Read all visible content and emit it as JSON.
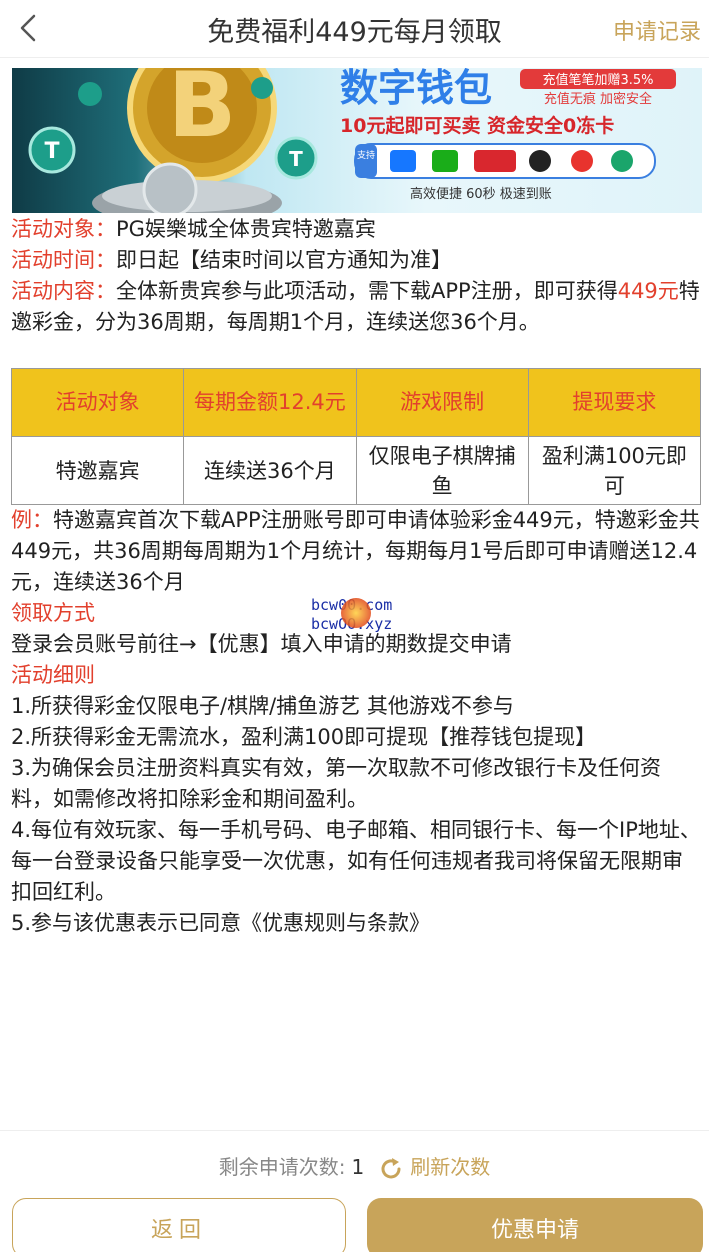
{
  "header": {
    "title": "免费福利449元每月领取",
    "records": "申请记录"
  },
  "banner": {
    "title": "数字钱包",
    "badge1": "充值笔笔加赠3.5%",
    "badge2": "充值无痕 加密安全",
    "line": "10元起即可买卖 资金安全0冻卡",
    "support": "支持",
    "tagline": "高效便捷 60秒 极速到账"
  },
  "info": {
    "target_label": "活动对象：",
    "target_value": "PG娱樂城全体贵宾特邀嘉宾",
    "time_label": "活动时间：",
    "time_value": "即日起【结束时间以官方通知为准】",
    "content_label": "活动内容：",
    "content_value": "全体新贵宾参与此项活动，需下载APP注册，即可获得",
    "content_amount": "449元",
    "content_rest": "特邀彩金，分为36周期，每周期1个月，连续送您36个月。"
  },
  "table": {
    "headers": [
      "活动对象",
      "每期金额12.4元",
      "游戏限制",
      "提现要求"
    ],
    "row": [
      "特邀嘉宾",
      "连续送36个月",
      "仅限电子棋牌捕鱼",
      "盈利满100元即可"
    ]
  },
  "example": {
    "label": "例：",
    "text": "特邀嘉宾首次下载APP注册账号即可申请体验彩金449元，特邀彩金共449元，共36周期每周期为1个月统计，每期每月1号后即可申请赠送12.4元，连续送36个月"
  },
  "claim": {
    "title": "领取方式",
    "text": "登录会员账号前往→【优惠】填入申请的期数提交申请"
  },
  "rules": {
    "title": "活动细则",
    "items": [
      "1.所获得彩金仅限电子/棋牌/捕鱼游艺 其他游戏不参与",
      "2.所获得彩金无需流水，盈利满100即可提现【推荐钱包提现】",
      "3.为确保会员注册资料真实有效，第一次取款不可修改银行卡及任何资料，如需修改将扣除彩金和期间盈利。",
      "4.每位有效玩家、每一手机号码、电子邮箱、相同银行卡、每一个IP地址、每一台登录设备只能享受一次优惠，如有任何违规者我司将保留无限期审扣回红利。",
      "5.参与该优惠表示已同意《优惠规则与条款》"
    ]
  },
  "watermark": {
    "line1": "bcw00.com",
    "line2": "bcwOO.xyz"
  },
  "footer": {
    "remain_label": "剩余申请次数:",
    "remain_count": "1",
    "refresh": "刷新次数",
    "back": "返回",
    "apply": "优惠申请"
  },
  "colors": {
    "accent": "#c8a45a",
    "red": "#e2402d",
    "table_header": "#f0c31c"
  }
}
